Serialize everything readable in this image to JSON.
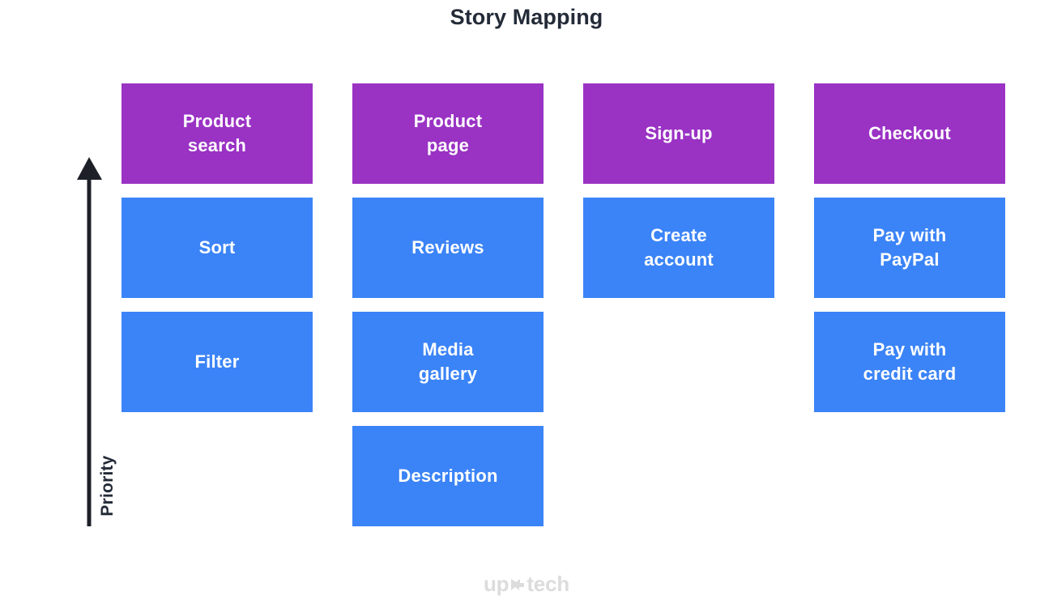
{
  "title": "Story Mapping",
  "axis": {
    "label": "Priority",
    "direction": "up",
    "icon": "up-arrow-icon",
    "color": "#1D2027"
  },
  "colors": {
    "activity": "#9A32C4",
    "story": "#3B84F7",
    "title_text": "#242B38",
    "card_text": "#FFFFFF",
    "logo_text": "#DCDCDC",
    "background": "#FFFFFF"
  },
  "board": {
    "columns": [
      {
        "name": "product-search",
        "cards": [
          {
            "label": "Product\nsearch",
            "type": "activity"
          },
          {
            "label": "Sort",
            "type": "story"
          },
          {
            "label": "Filter",
            "type": "story"
          }
        ]
      },
      {
        "name": "product-page",
        "cards": [
          {
            "label": "Product\npage",
            "type": "activity"
          },
          {
            "label": "Reviews",
            "type": "story"
          },
          {
            "label": "Media\ngallery",
            "type": "story"
          },
          {
            "label": "Description",
            "type": "story"
          }
        ]
      },
      {
        "name": "sign-up",
        "cards": [
          {
            "label": "Sign-up",
            "type": "activity"
          },
          {
            "label": "Create\naccount",
            "type": "story"
          }
        ]
      },
      {
        "name": "checkout",
        "cards": [
          {
            "label": "Checkout",
            "type": "activity"
          },
          {
            "label": "Pay with\nPayPal",
            "type": "story"
          },
          {
            "label": "Pay with\ncredit card",
            "type": "story"
          }
        ]
      }
    ]
  },
  "logo": {
    "text_left": "up",
    "text_right": "tech",
    "mark": "arrow-dart-icon"
  }
}
